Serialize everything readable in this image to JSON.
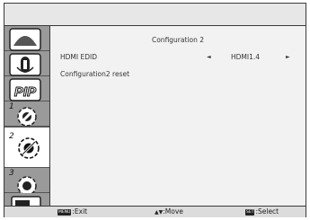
{
  "menu": {
    "icons": [
      {
        "icon": "picture-icon"
      },
      {
        "icon": "audio-icon"
      },
      {
        "icon": "pip-icon",
        "label": "PIP"
      },
      {
        "icon": "configuration1-icon",
        "number": "1"
      },
      {
        "icon": "configuration2-icon",
        "number": "2",
        "selected": true
      },
      {
        "icon": "advanced-option-icon",
        "number": "3"
      },
      {
        "icon": "input-icon"
      }
    ]
  },
  "content": {
    "title": "Configuration 2",
    "rows": [
      {
        "label": "HDMI EDID",
        "value": "HDMI1.4",
        "left_arrow": "◄",
        "right_arrow": "►"
      },
      {
        "label": "Configuration2 reset"
      }
    ]
  },
  "footer": {
    "exit": {
      "key": "MENU",
      "label": ":Exit"
    },
    "move": {
      "key": "▲▼",
      "label": ":Move"
    },
    "select": {
      "key": "SET",
      "label": ":Select"
    }
  },
  "colors": {
    "sidebar_bg": "#9a9a9a",
    "selected_bg": "#ffffff",
    "content_bg": "#f2f2f2"
  }
}
